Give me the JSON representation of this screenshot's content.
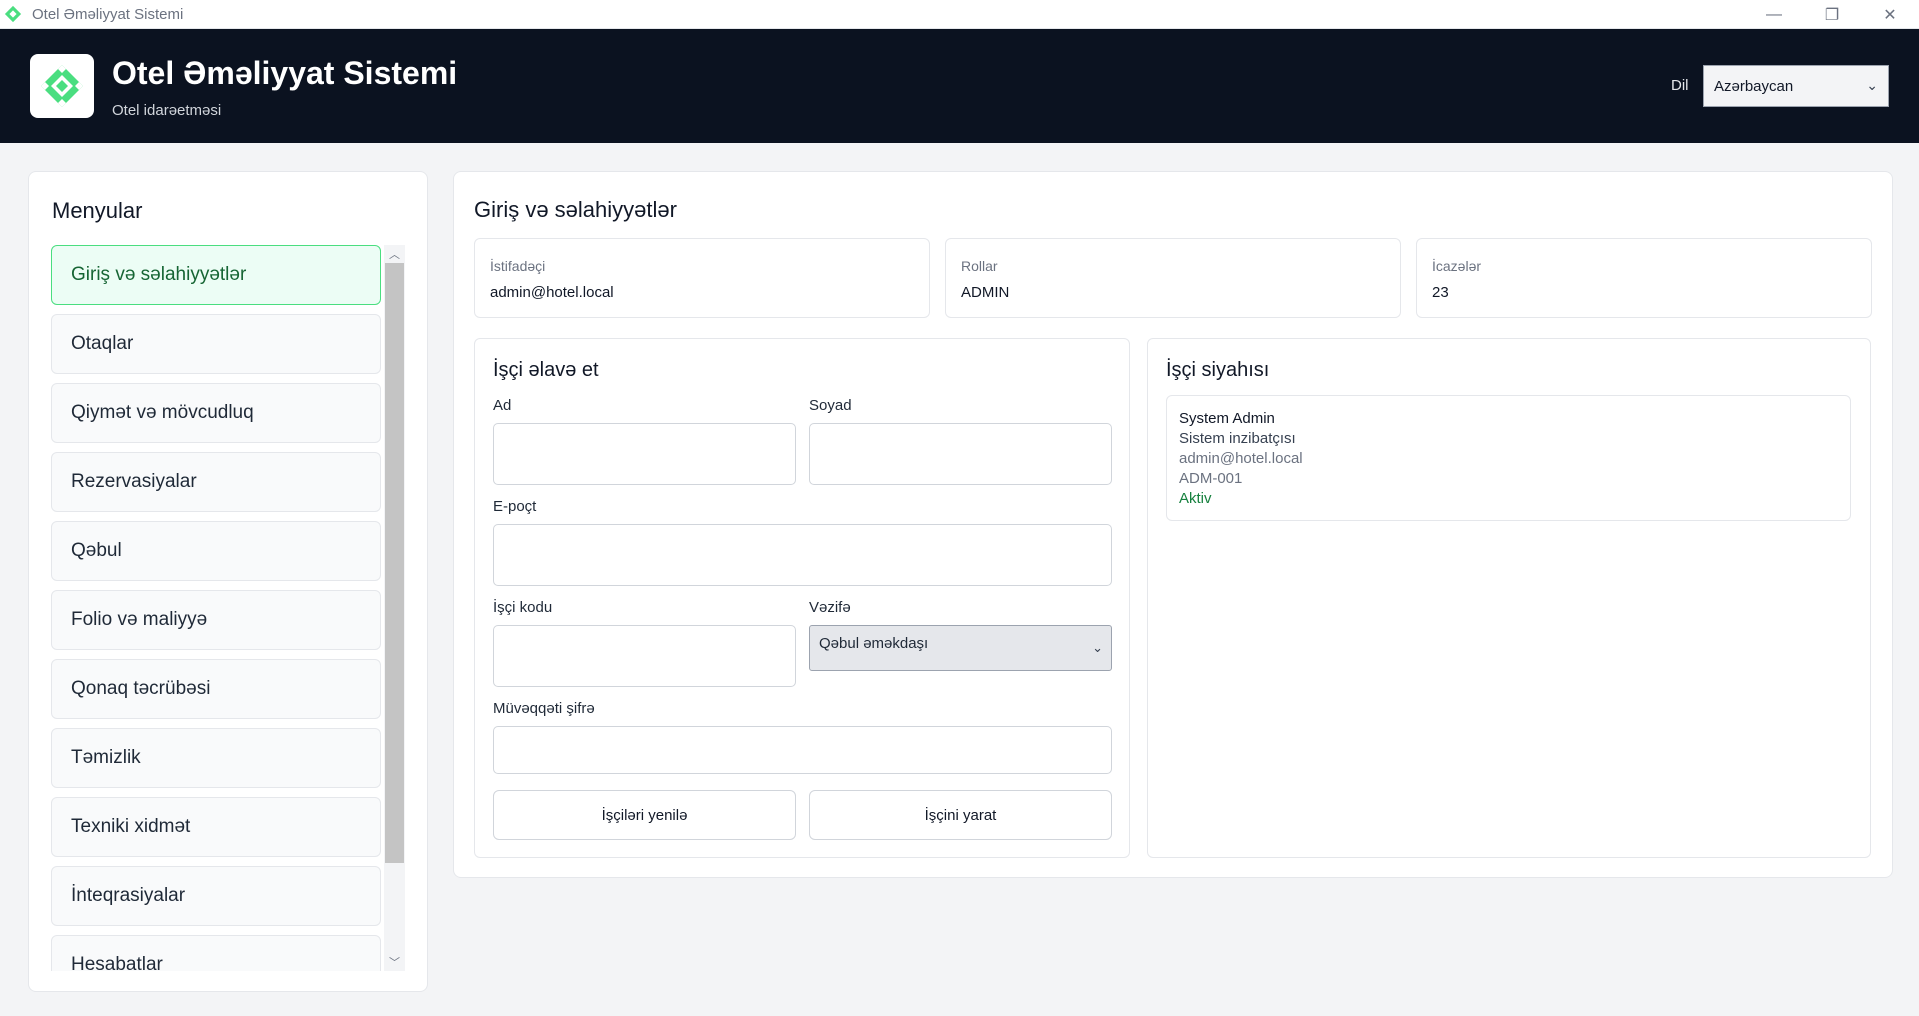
{
  "window": {
    "title": "Otel Əməliyyat Sistemi",
    "controls": {
      "minimize": "—",
      "maximize": "❐",
      "close": "✕"
    }
  },
  "header": {
    "app_title": "Otel Əməliyyat Sistemi",
    "app_subtitle": "Otel idarəetməsi",
    "language_label": "Dil",
    "language_value": "Azərbaycan",
    "brand_color": "#4ade80"
  },
  "sidebar": {
    "title": "Menyular",
    "items": [
      {
        "label": "Giriş və səlahiyyətlər",
        "active": true
      },
      {
        "label": "Otaqlar"
      },
      {
        "label": "Qiymət və mövcudluq"
      },
      {
        "label": "Rezervasiyalar"
      },
      {
        "label": "Qəbul"
      },
      {
        "label": "Folio və maliyyə"
      },
      {
        "label": "Qonaq təcrübəsi"
      },
      {
        "label": "Təmizlik"
      },
      {
        "label": "Texniki xidmət"
      },
      {
        "label": "İnteqrasiyalar"
      },
      {
        "label": "Hesabatlar"
      }
    ]
  },
  "main": {
    "title": "Giriş və səlahiyyətlər",
    "info_cards": [
      {
        "label": "İstifadəçi",
        "value": "admin@hotel.local"
      },
      {
        "label": "Rollar",
        "value": "ADMIN"
      },
      {
        "label": "İcazələr",
        "value": "23"
      }
    ],
    "add_employee": {
      "title": "İşçi əlavə et",
      "first_name_label": "Ad",
      "first_name_value": "",
      "last_name_label": "Soyad",
      "last_name_value": "",
      "email_label": "E-poçt",
      "email_value": "",
      "employee_code_label": "İşçi kodu",
      "employee_code_value": "",
      "position_label": "Vəzifə",
      "position_value": "Qəbul əməkdaşı",
      "temp_password_label": "Müvəqqəti şifrə",
      "temp_password_value": "",
      "refresh_button": "İşçiləri yenilə",
      "create_button": "İşçini yarat"
    },
    "employee_list": {
      "title": "İşçi siyahısı",
      "employees": [
        {
          "name": "System Admin",
          "role": "Sistem inzibatçısı",
          "email": "admin@hotel.local",
          "code": "ADM-001",
          "status": "Aktiv",
          "status_color": "#15803d"
        }
      ]
    }
  }
}
